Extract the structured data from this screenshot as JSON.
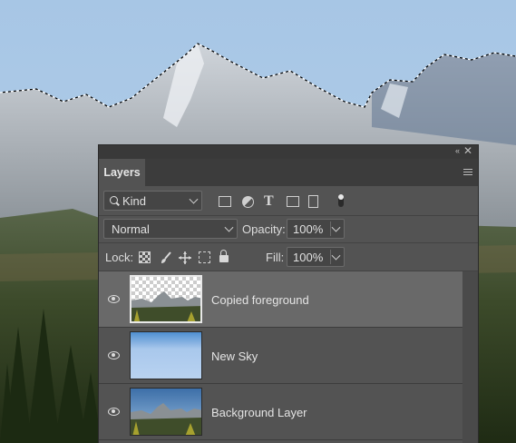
{
  "panel": {
    "tab_label": "Layers",
    "collapse_glyph": "«",
    "close_glyph": "✕"
  },
  "filter": {
    "kind_label": "Kind"
  },
  "blend": {
    "mode": "Normal",
    "opacity_label": "Opacity:",
    "opacity_value": "100%"
  },
  "lock": {
    "label": "Lock:",
    "fill_label": "Fill:",
    "fill_value": "100%"
  },
  "layers": [
    {
      "name": "Copied foreground",
      "selected": true,
      "visible": true
    },
    {
      "name": "New Sky",
      "selected": false,
      "visible": true
    },
    {
      "name": "Background Layer",
      "selected": false,
      "visible": true
    }
  ],
  "icons": {
    "filter_icons": [
      "pixel-layer-filter-icon",
      "adjustment-layer-filter-icon",
      "type-layer-filter-icon",
      "shape-layer-filter-icon",
      "smart-object-filter-icon"
    ],
    "lock_icons": [
      "lock-transparent-pixels-icon",
      "lock-image-pixels-icon",
      "lock-position-icon",
      "lock-artboard-icon",
      "lock-all-icon"
    ]
  },
  "colors": {
    "panel_bg": "#535353",
    "selected_row": "#696969",
    "sky": "#a9c8e6"
  }
}
